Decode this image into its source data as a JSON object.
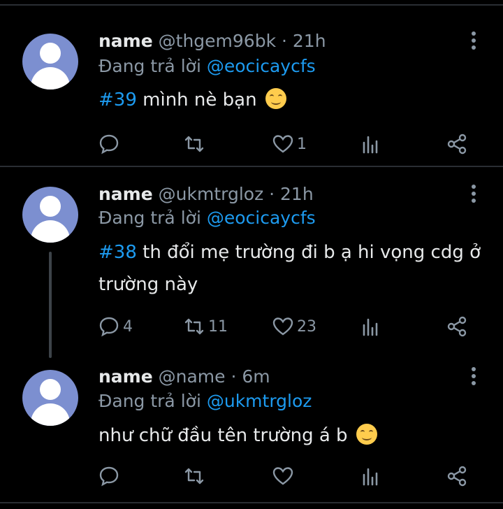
{
  "tweets": [
    {
      "name": "name",
      "handle_time": "@thgem96bk · 21h",
      "reply_prefix": "Đang trả lời",
      "reply_to": "@eocicaycfs",
      "hashtag": "#39",
      "text": " mình nè bạn",
      "emoji": "smiling-face",
      "comments": "",
      "retweets": "",
      "likes": "1"
    },
    {
      "name": "name",
      "handle_time": "@ukmtrgloz · 21h",
      "reply_prefix": "Đang trả lời",
      "reply_to": "@eocicaycfs",
      "hashtag": "#38",
      "text_line1": " th đổi mẹ trường đi b ạ hi vọng cdg ở",
      "text_line2": "trường này",
      "comments": "4",
      "retweets": "11",
      "likes": "23"
    },
    {
      "name": "name",
      "handle_time": "@name · 6m",
      "reply_prefix": "Đang trả lời",
      "reply_to": "@ukmtrgloz",
      "text": "như chữ đầu tên trường á b",
      "emoji": "smiling-face",
      "comments": "",
      "retweets": "",
      "likes": ""
    }
  ],
  "colors": {
    "background": "#000000",
    "text": "#e7e9ea",
    "muted": "#8b98a5",
    "accent": "#1d9bf0",
    "avatar": "#7c8fd0"
  }
}
